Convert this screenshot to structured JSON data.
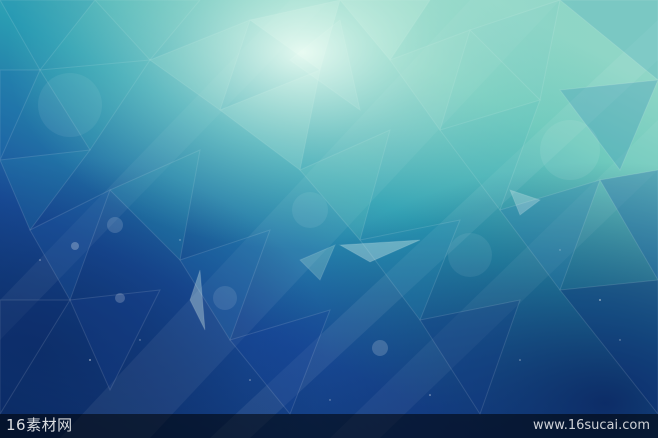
{
  "image": {
    "subject": "abstract-low-poly-background",
    "palette": {
      "highlight": "#d9f2e8",
      "mint": "#7fd3c4",
      "teal": "#2aa3b3",
      "cyan": "#1f8fb5",
      "blue": "#1f5ea8",
      "deep_blue": "#123b86",
      "navy": "#0b2a63"
    }
  },
  "watermark": {
    "left_text": "16素材网",
    "right_text": "www.16sucai.com"
  }
}
